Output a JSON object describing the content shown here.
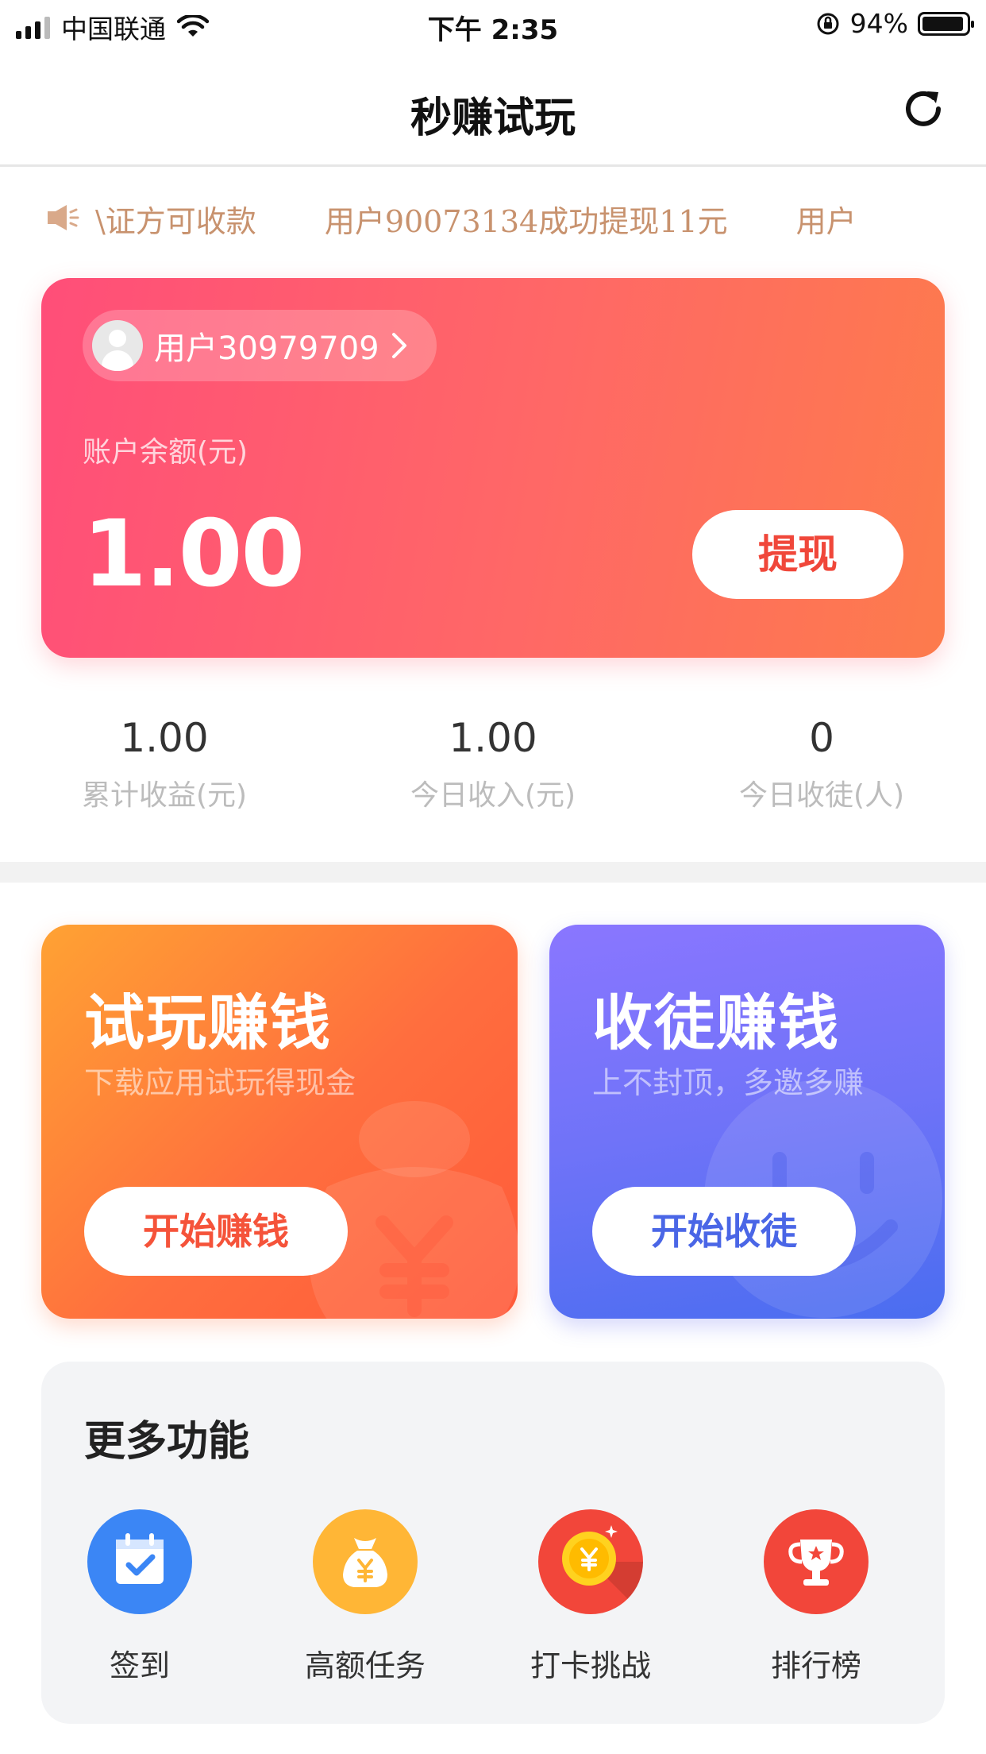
{
  "status_bar": {
    "carrier": "中国联通",
    "time": "下午 2:35",
    "battery": "94%",
    "battery_level": 0.94
  },
  "nav": {
    "title": "秒赚试玩",
    "refresh_icon": "refresh-icon"
  },
  "ticker": {
    "icon": "speaker-icon",
    "messages": [
      "\\证方可收款",
      "用户90073134成功提现11元",
      "用户"
    ]
  },
  "account": {
    "username": "用户30979709",
    "balance_label": "账户余额(元)",
    "balance": "1.00",
    "withdraw_label": "提现"
  },
  "stats": [
    {
      "value": "1.00",
      "label": "累计收益(元)"
    },
    {
      "value": "1.00",
      "label": "今日收入(元)"
    },
    {
      "value": "0",
      "label": "今日收徒(人)"
    }
  ],
  "promos": {
    "trial": {
      "title": "试玩赚钱",
      "subtitle": "下载应用试玩得现金",
      "button": "开始赚钱"
    },
    "invite": {
      "title": "收徒赚钱",
      "subtitle": "上不封顶，多邀多赚",
      "button": "开始收徒"
    }
  },
  "more": {
    "title": "更多功能",
    "items": [
      {
        "label": "签到",
        "icon": "calendar-check-icon",
        "color": "#3b86f5"
      },
      {
        "label": "高额任务",
        "icon": "money-bag-icon",
        "color": "#ffb636"
      },
      {
        "label": "打卡挑战",
        "icon": "coin-icon",
        "color": "#f2463a"
      },
      {
        "label": "排行榜",
        "icon": "trophy-icon",
        "color": "#f2463a"
      }
    ]
  }
}
